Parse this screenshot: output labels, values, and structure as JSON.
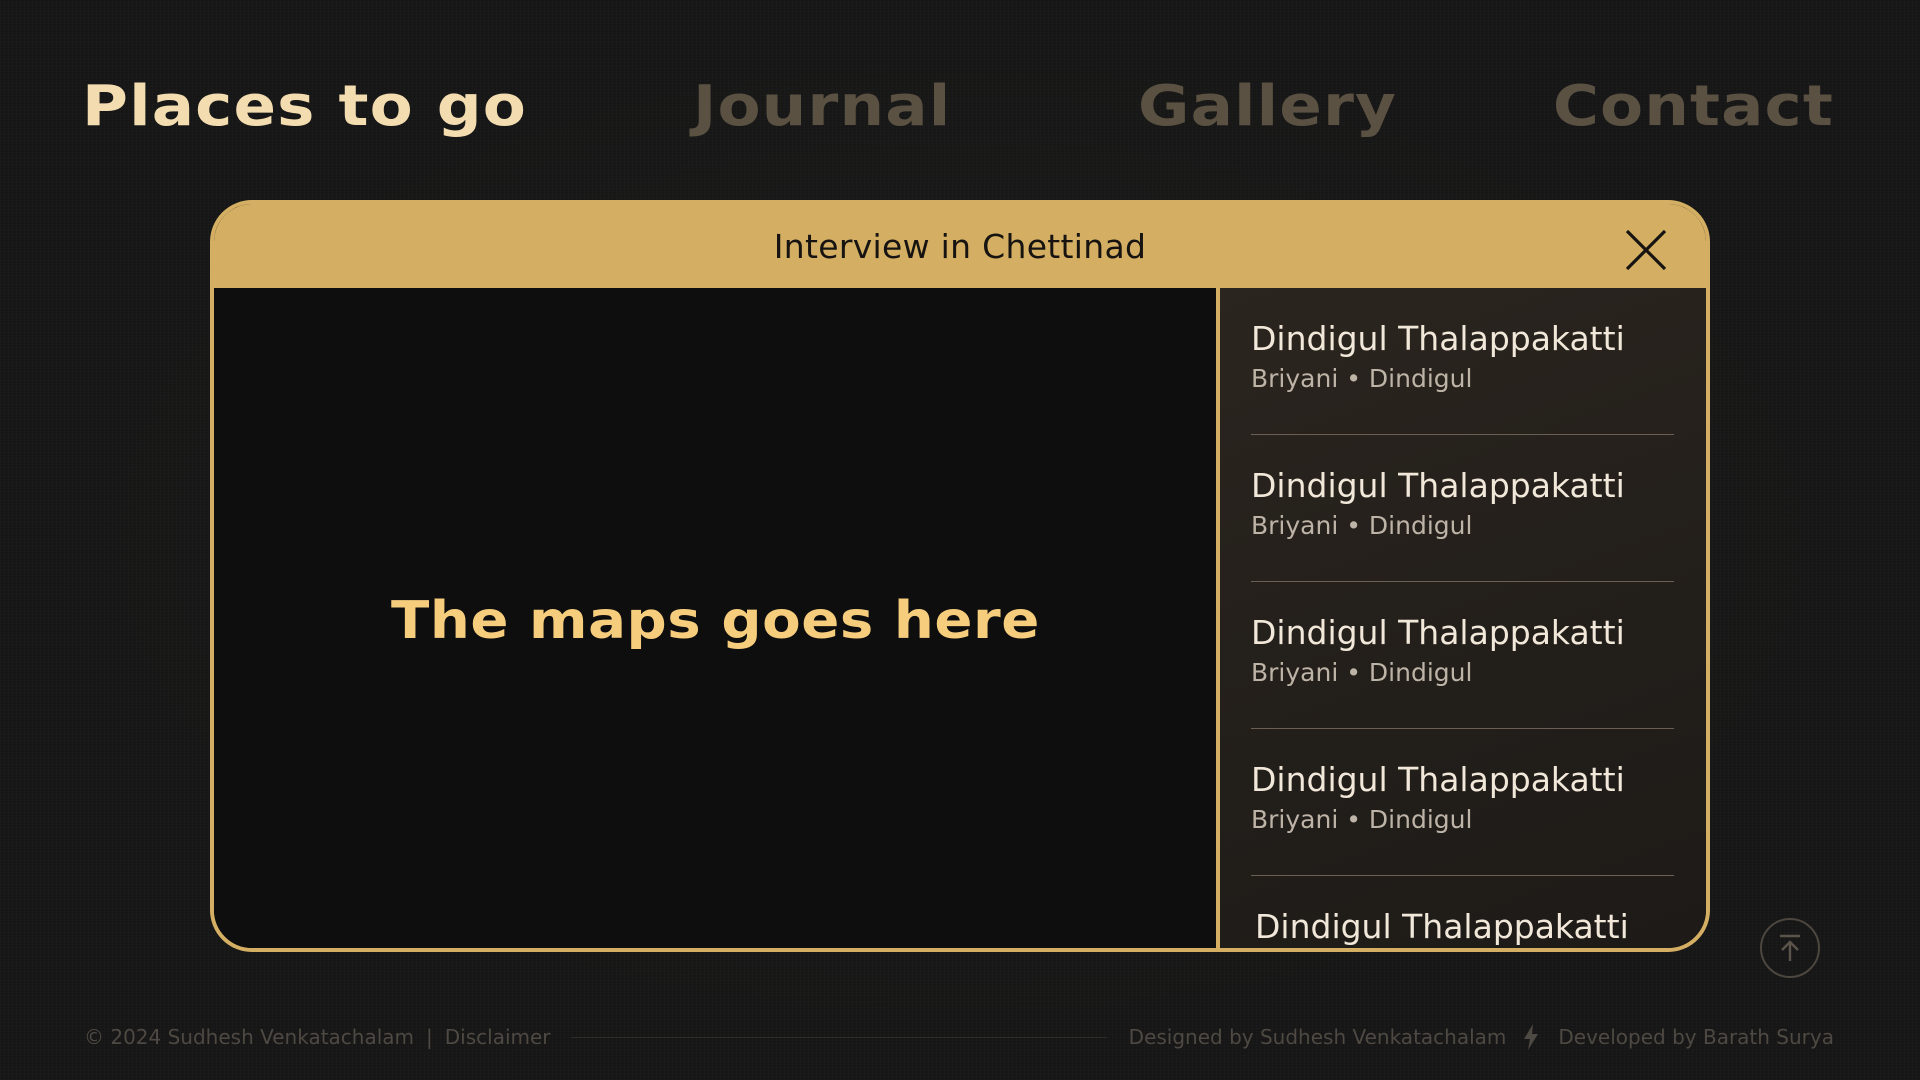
{
  "nav": {
    "items": [
      {
        "label": "Places to go",
        "active": true
      },
      {
        "label": "Journal",
        "active": false
      },
      {
        "label": "Gallery",
        "active": false
      },
      {
        "label": "Contact",
        "active": false
      }
    ]
  },
  "modal": {
    "title": "Interview in Chettinad",
    "close_icon": "close-icon",
    "map_placeholder": "The maps goes here",
    "list": [
      {
        "title": "Dindigul Thalappakatti",
        "subtitle": "Briyani • Dindigul"
      },
      {
        "title": "Dindigul Thalappakatti",
        "subtitle": "Briyani • Dindigul"
      },
      {
        "title": "Dindigul Thalappakatti",
        "subtitle": "Briyani • Dindigul"
      },
      {
        "title": "Dindigul Thalappakatti",
        "subtitle": "Briyani • Dindigul"
      },
      {
        "title": "Dindigul Thalappakatti"
      }
    ]
  },
  "scroll_top_icon": "arrow-up-to-top-icon",
  "footer": {
    "copyright": "© 2024 Sudhesh Venkatachalam",
    "separator": "|",
    "disclaimer": "Disclaimer",
    "designed_by": "Designed by Sudhesh Venkatachalam",
    "bolt_icon": "lightning-icon",
    "developed_by": "Developed by Barath Surya"
  },
  "colors": {
    "accent": "#d4af63",
    "nav_active": "#f3ddb0",
    "nav_inactive": "#5a5142",
    "map_text": "#f6cd7d",
    "background": "#161616"
  }
}
